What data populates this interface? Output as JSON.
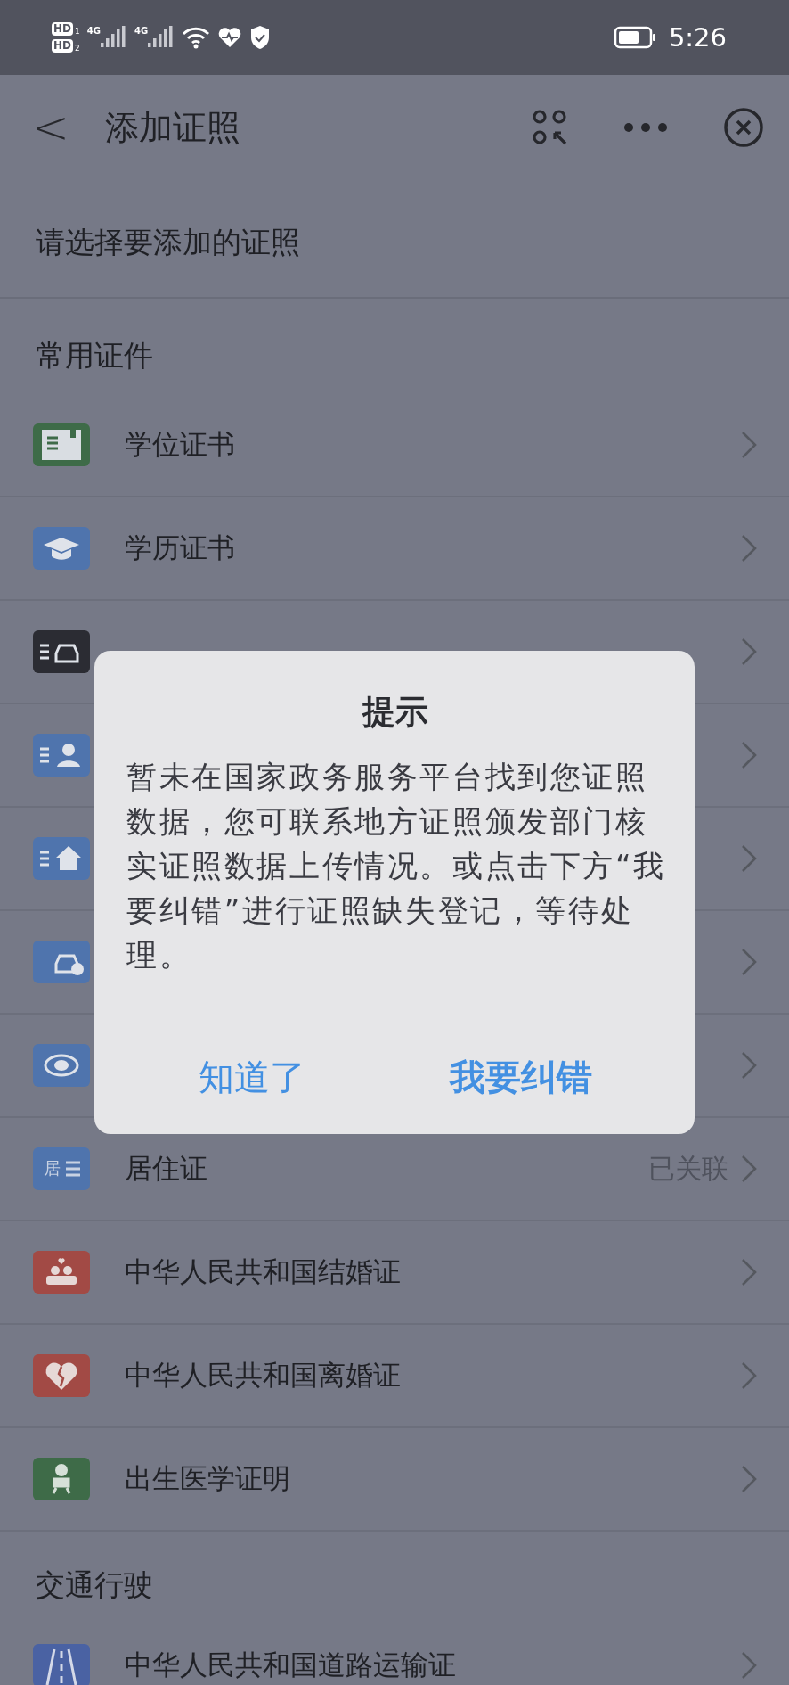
{
  "status_bar": {
    "sim_badges": [
      {
        "label": "HD",
        "slot": "1"
      },
      {
        "label": "HD",
        "slot": "2"
      }
    ],
    "networks": [
      "4G",
      "4G"
    ],
    "time": "5:26"
  },
  "header": {
    "back": "<",
    "title": "添加证照"
  },
  "prompt": "请选择要添加的证照",
  "sections": [
    {
      "title": "常用证件",
      "rows": [
        {
          "kind": "book",
          "color": "#3e6b48",
          "label": "学位证书"
        },
        {
          "kind": "cap",
          "color": "#4f74ad",
          "label": "学历证书"
        },
        {
          "kind": "car-card",
          "color": "#2b2c33"
        },
        {
          "kind": "person-card",
          "color": "#4f74ad"
        },
        {
          "kind": "house-card",
          "color": "#4f74ad"
        },
        {
          "kind": "car-check",
          "color": "#4f74ad"
        },
        {
          "kind": "oval",
          "color": "#4f74ad"
        },
        {
          "kind": "text-card",
          "color": "#4f74ad",
          "icon_text": "居",
          "label": "居住证",
          "status": "已关联"
        },
        {
          "kind": "couple",
          "color": "#a24a45",
          "label": "中华人民共和国结婚证"
        },
        {
          "kind": "broken-heart",
          "color": "#a24a45",
          "label": "中华人民共和国离婚证"
        },
        {
          "kind": "baby",
          "color": "#3e6b48",
          "label": "出生医学证明"
        }
      ]
    },
    {
      "title": "交通行驶",
      "rows": [
        {
          "kind": "road",
          "color": "#4a62a3",
          "label": "中华人民共和国道路运输证"
        }
      ]
    }
  ],
  "dialog": {
    "title": "提示",
    "message": "暂未在国家政务服务平台找到您证照数据，您可联系地方证照颁发部门核实证照数据上传情况。或点击下方“我要纠错”进行证照缺失登记，等待处理。",
    "buttons": [
      "知道了",
      "我要纠错"
    ]
  }
}
